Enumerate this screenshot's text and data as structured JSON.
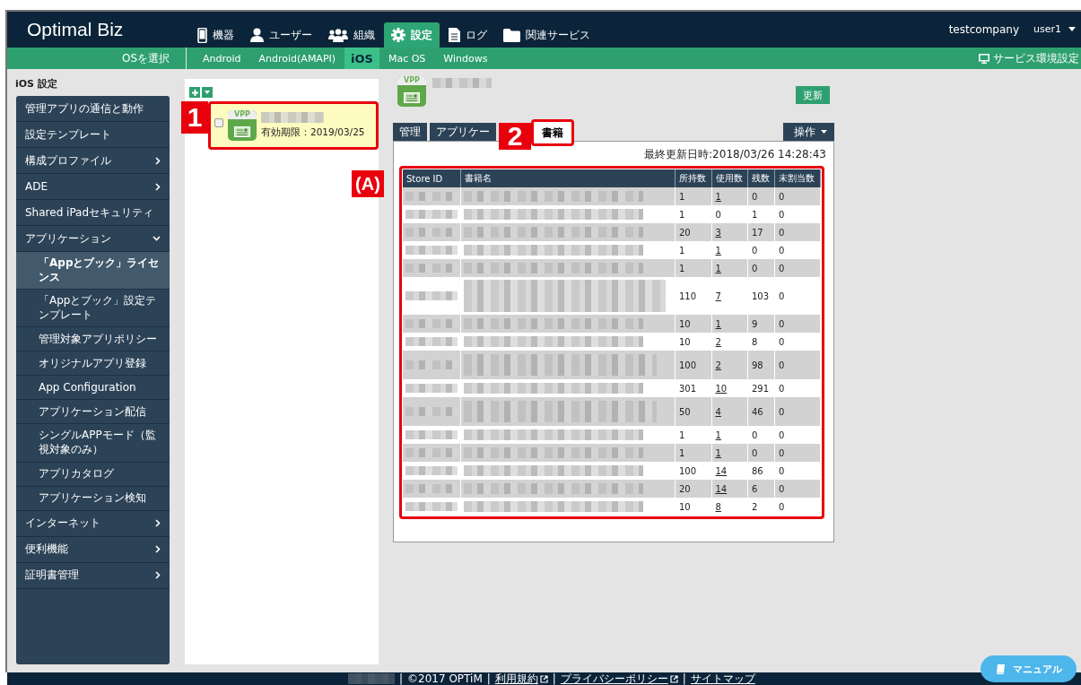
{
  "header": {
    "logo": "Optimal Biz",
    "nav": [
      {
        "label": "機器",
        "selected": false
      },
      {
        "label": "ユーザー",
        "selected": false
      },
      {
        "label": "組織",
        "selected": false
      },
      {
        "label": "設定",
        "selected": true
      },
      {
        "label": "ログ",
        "selected": false
      },
      {
        "label": "関連サービス",
        "selected": false
      }
    ],
    "company": "testcompany",
    "user": "user1"
  },
  "os_bar": {
    "label": "OSを選択",
    "items": [
      {
        "label": "Android",
        "selected": false
      },
      {
        "label": "Android(AMAPI)",
        "selected": false
      },
      {
        "label": "iOS",
        "selected": true
      },
      {
        "label": "Mac OS",
        "selected": false
      },
      {
        "label": "Windows",
        "selected": false
      }
    ],
    "service_settings": "サービス環境設定"
  },
  "section_title": "iOS 設定",
  "sidebar": {
    "items": [
      {
        "label": "管理アプリの通信と動作",
        "kind": "link",
        "selected": false
      },
      {
        "label": "設定テンプレート",
        "kind": "link",
        "selected": false
      },
      {
        "label": "構成プロファイル",
        "kind": "group",
        "expanded": false
      },
      {
        "label": "ADE",
        "kind": "group",
        "expanded": false
      },
      {
        "label": "Shared iPadセキュリティ",
        "kind": "link",
        "selected": false
      },
      {
        "label": "アプリケーション",
        "kind": "group",
        "expanded": true,
        "children": [
          {
            "label": "「Appとブック」ライセンス",
            "selected": true
          },
          {
            "label": "「Appとブック」設定テンプレート",
            "selected": false
          },
          {
            "label": "管理対象アプリポリシー",
            "selected": false
          },
          {
            "label": "オリジナルアプリ登録",
            "selected": false
          },
          {
            "label": "App Configuration",
            "selected": false
          },
          {
            "label": "アプリケーション配信",
            "selected": false
          },
          {
            "label": "シングルAPPモード（監視対象のみ）",
            "selected": false
          },
          {
            "label": "アプリカタログ",
            "selected": false
          },
          {
            "label": "アプリケーション検知",
            "selected": false
          }
        ]
      },
      {
        "label": "インターネット",
        "kind": "group",
        "expanded": false
      },
      {
        "label": "便利機能",
        "kind": "group",
        "expanded": false
      },
      {
        "label": "証明書管理",
        "kind": "group",
        "expanded": false
      }
    ]
  },
  "license_list": {
    "items": [
      {
        "badge": "VPP",
        "expiry": "有効期限：2019/03/25",
        "checked": false,
        "selected": true
      }
    ]
  },
  "detail": {
    "badge": "VPP",
    "update_button": "更新",
    "tabs": [
      {
        "label": "管理",
        "selected": false
      },
      {
        "label": "アプリケー",
        "selected": false
      },
      {
        "label": "書籍",
        "selected": true
      }
    ],
    "actions_button": "操作",
    "last_updated": "最終更新日時:2018/03/26 14:28:43",
    "table": {
      "columns": [
        "Store ID",
        "書籍名",
        "所持数",
        "使用数",
        "残数",
        "未割当数"
      ],
      "rows": [
        {
          "kind": "single",
          "owned": "1",
          "used": "1",
          "used_link": true,
          "remaining": "0",
          "unassigned": "0"
        },
        {
          "kind": "single",
          "owned": "1",
          "used": "0",
          "used_link": false,
          "remaining": "1",
          "unassigned": "0"
        },
        {
          "kind": "single",
          "owned": "20",
          "used": "3",
          "used_link": true,
          "remaining": "17",
          "unassigned": "0"
        },
        {
          "kind": "single",
          "owned": "1",
          "used": "1",
          "used_link": true,
          "remaining": "0",
          "unassigned": "0"
        },
        {
          "kind": "single",
          "owned": "1",
          "used": "1",
          "used_link": true,
          "remaining": "0",
          "unassigned": "0"
        },
        {
          "kind": "triple",
          "owned": "110",
          "used": "7",
          "used_link": true,
          "remaining": "103",
          "unassigned": "0"
        },
        {
          "kind": "single",
          "owned": "10",
          "used": "1",
          "used_link": true,
          "remaining": "9",
          "unassigned": "0"
        },
        {
          "kind": "single",
          "owned": "10",
          "used": "2",
          "used_link": true,
          "remaining": "8",
          "unassigned": "0"
        },
        {
          "kind": "double",
          "owned": "100",
          "used": "2",
          "used_link": true,
          "remaining": "98",
          "unassigned": "0"
        },
        {
          "kind": "single",
          "owned": "301",
          "used": "10",
          "used_link": true,
          "remaining": "291",
          "unassigned": "0"
        },
        {
          "kind": "double",
          "owned": "50",
          "used": "4",
          "used_link": true,
          "remaining": "46",
          "unassigned": "0"
        },
        {
          "kind": "single",
          "owned": "1",
          "used": "1",
          "used_link": true,
          "remaining": "0",
          "unassigned": "0"
        },
        {
          "kind": "single",
          "owned": "1",
          "used": "1",
          "used_link": true,
          "remaining": "0",
          "unassigned": "0"
        },
        {
          "kind": "single",
          "owned": "100",
          "used": "14",
          "used_link": true,
          "remaining": "86",
          "unassigned": "0"
        },
        {
          "kind": "single",
          "owned": "20",
          "used": "14",
          "used_link": true,
          "remaining": "6",
          "unassigned": "0"
        },
        {
          "kind": "single",
          "owned": "10",
          "used": "8",
          "used_link": true,
          "remaining": "2",
          "unassigned": "0"
        }
      ]
    }
  },
  "footer": {
    "separator": "|",
    "copyright": "©2017 OPTiM",
    "links": [
      {
        "label": "利用規約",
        "external": true
      },
      {
        "label": "プライバシーポリシー",
        "external": true
      },
      {
        "label": "サイトマップ",
        "external": false
      }
    ]
  },
  "manual_button": "マニュアル",
  "annotations": [
    {
      "label": "1"
    },
    {
      "label": "2"
    },
    {
      "label": "(A)"
    }
  ]
}
